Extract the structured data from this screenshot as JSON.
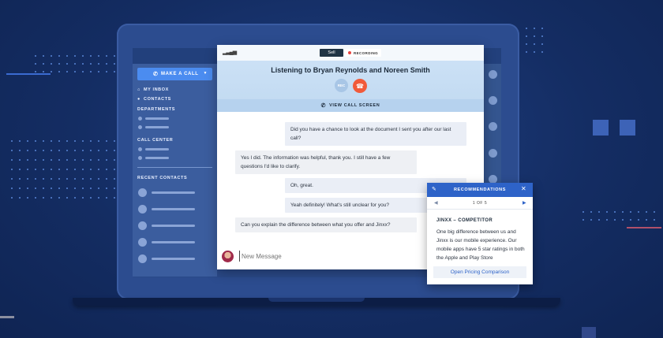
{
  "sidebar": {
    "call_button": "MAKE A CALL",
    "items": [
      {
        "label": "MY INBOX",
        "icon": "home-icon"
      },
      {
        "label": "CONTACTS",
        "icon": "person-icon"
      }
    ],
    "departments_label": "DEPARTMENTS",
    "call_center_label": "CALL CENTER",
    "recent_contacts_label": "RECENT CONTACTS"
  },
  "call": {
    "tab_sell": "Sell",
    "recording": "RECORDING",
    "title": "Listening to Bryan Reynolds and Noreen Smith",
    "rec_button": "REC",
    "view_call_screen": "VIEW CALL SCREEN"
  },
  "messages": [
    {
      "side": "right",
      "text": "Did you have a chance to look at the document I sent you after our last call?"
    },
    {
      "side": "left",
      "text": "Yes I did. The information was helpful, thank you. I still have a few questions I'd like to clarify."
    },
    {
      "side": "right",
      "text": "Oh, great."
    },
    {
      "side": "right",
      "text": "Yeah definitely! What's still unclear for you?"
    },
    {
      "side": "left",
      "text": "Can you explain the difference between what you offer and Jinxx?"
    }
  ],
  "composer": {
    "placeholder": "New Message"
  },
  "recommendations": {
    "title": "RECOMMENDATIONS",
    "pager": "1 OF 5",
    "subtitle": "JINXX – COMPETITOR",
    "body": "One big difference between us and Jinxx is our mobile experience. Our mobile apps have 5 star ratings in both the Apple and Play Store",
    "link": "Open Pricing Comparison"
  },
  "colors": {
    "accent": "#2e63c8",
    "hangup": "#f15a3a",
    "recording_dot": "#e8433e",
    "background": "#142d63"
  }
}
